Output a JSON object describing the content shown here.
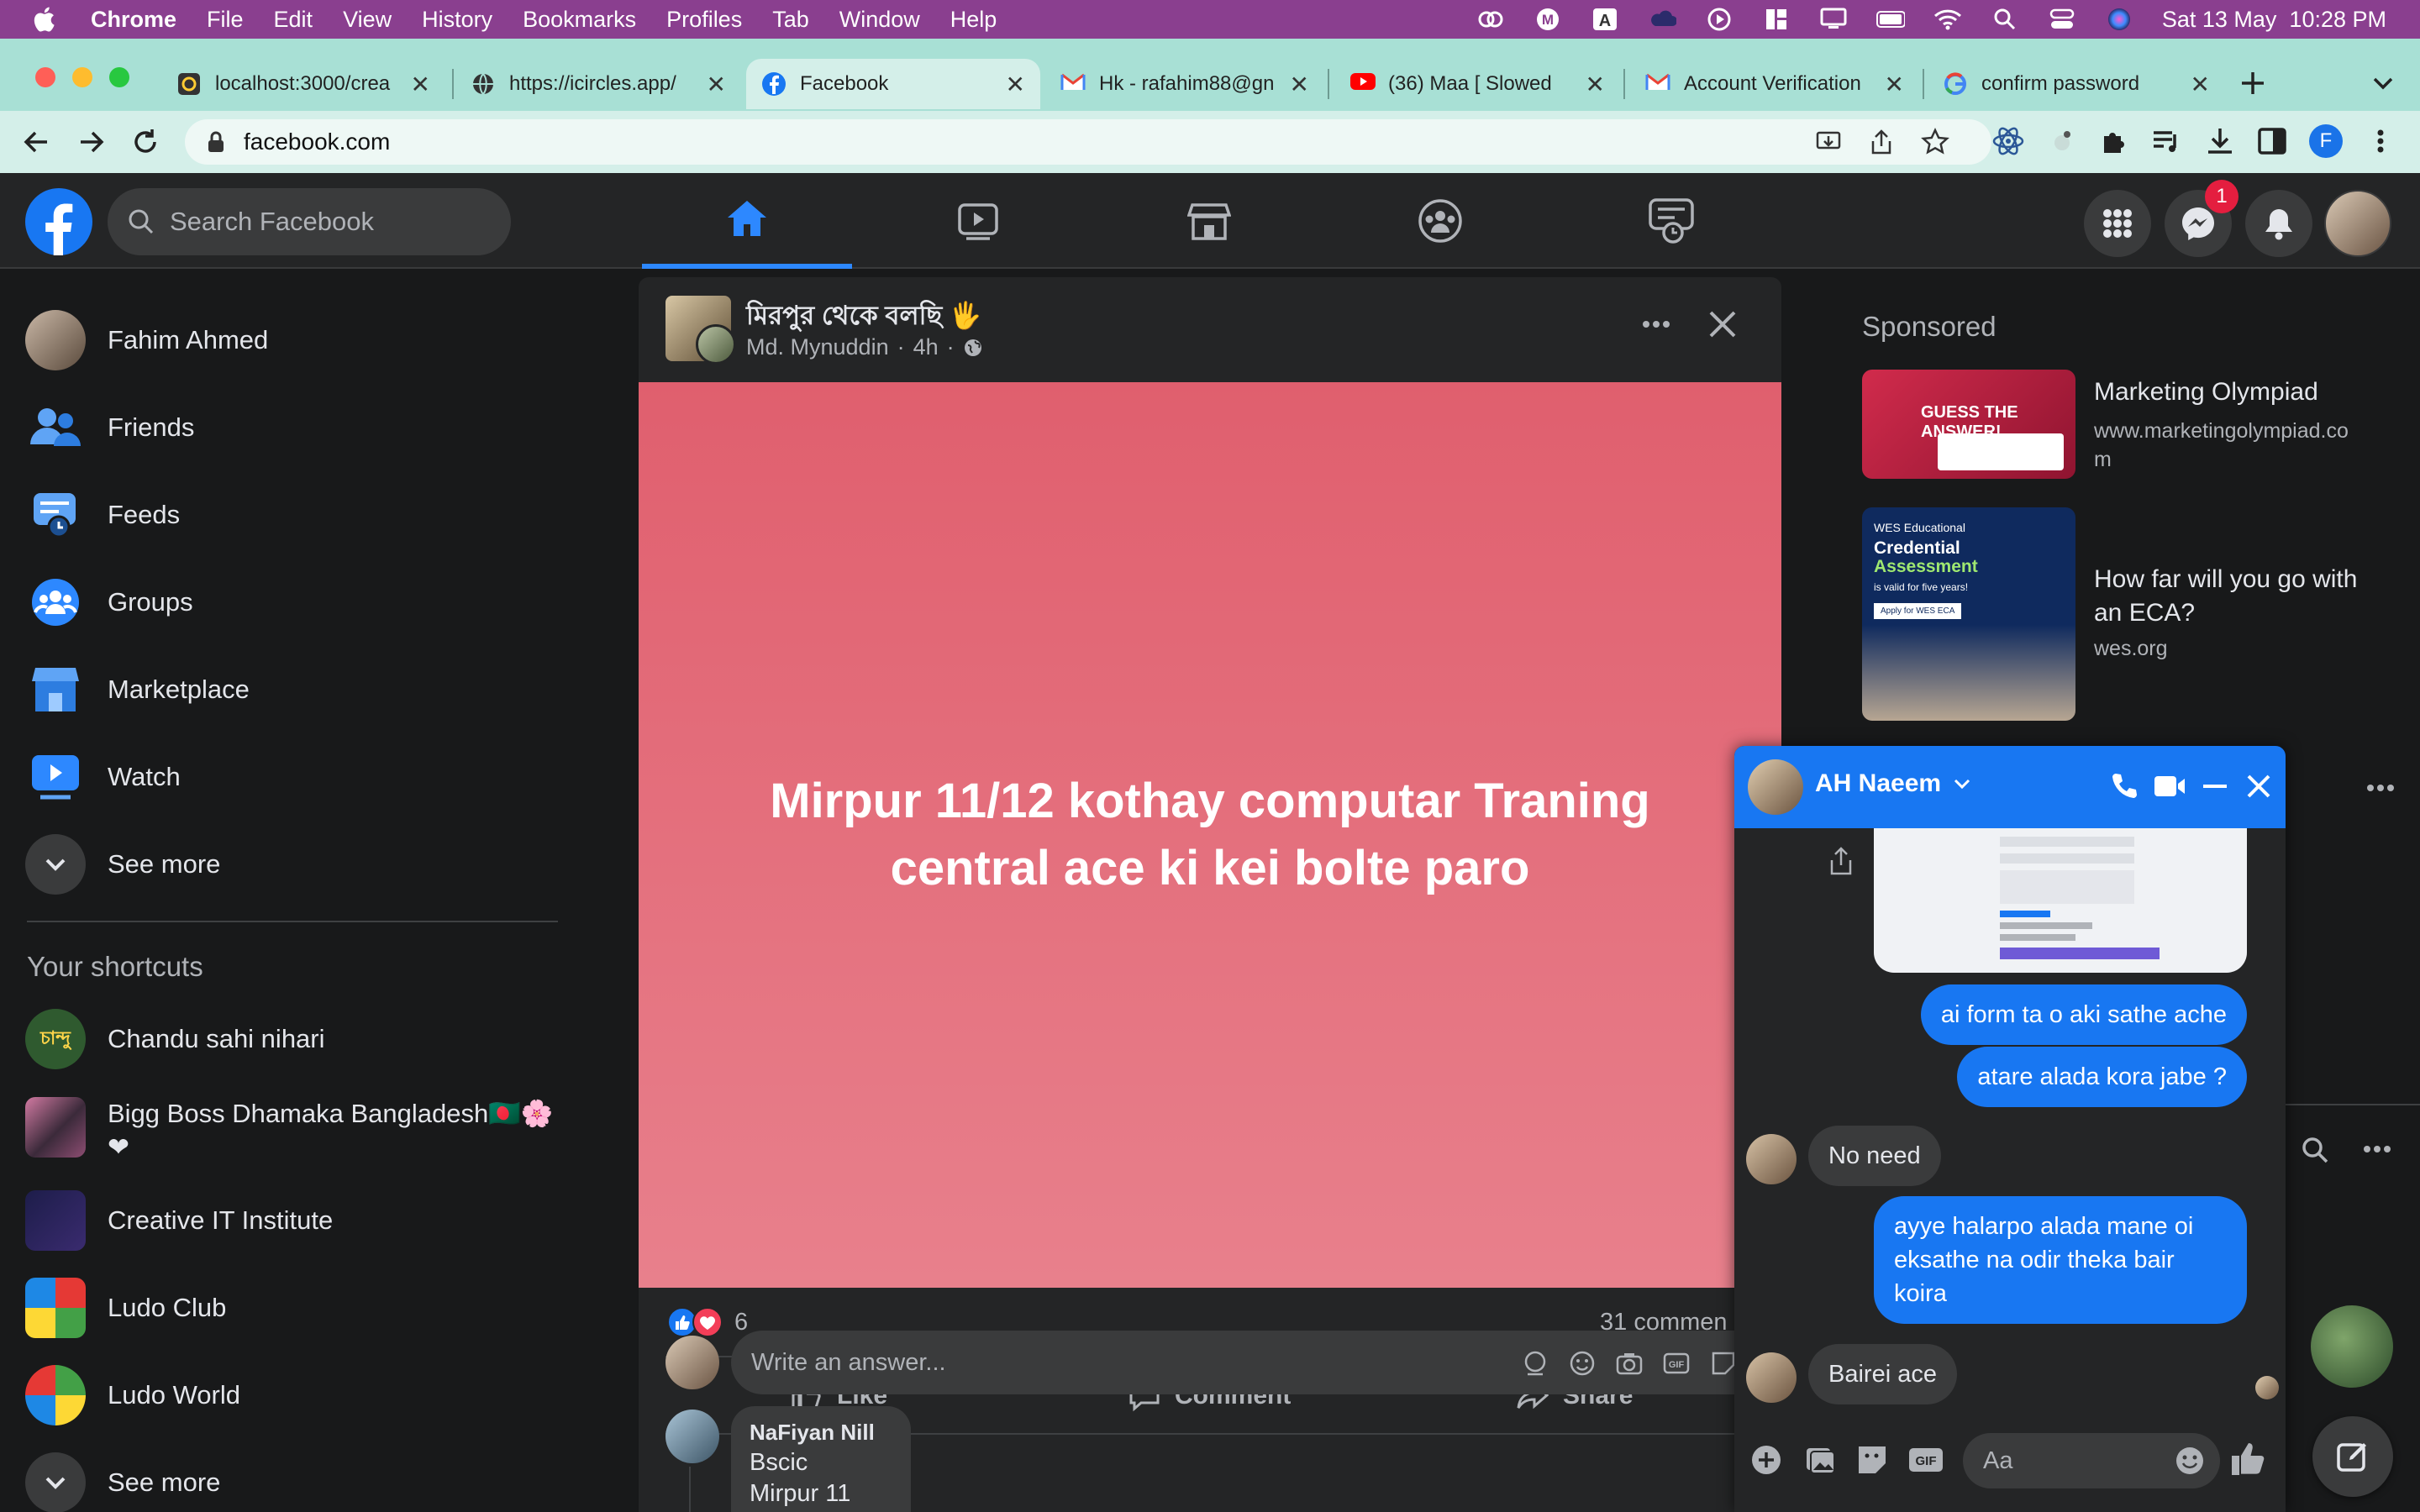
{
  "menubar": {
    "app_name": "Chrome",
    "items": [
      "File",
      "Edit",
      "View",
      "History",
      "Bookmarks",
      "Profiles",
      "Tab",
      "Window",
      "Help"
    ],
    "clock": "Sat 13 May  10:28 PM"
  },
  "browser": {
    "tabs": [
      {
        "label": "localhost:3000/crea",
        "icon": "localhost-favicon"
      },
      {
        "label": "https://icircles.app/",
        "icon": "globe-icon"
      },
      {
        "label": "Facebook",
        "icon": "facebook-favicon"
      },
      {
        "label": "Hk - rafahim88@gn",
        "icon": "gmail-icon"
      },
      {
        "label": "(36) Maa [ Slowed",
        "icon": "youtube-icon"
      },
      {
        "label": "Account Verification",
        "icon": "gmail-icon"
      },
      {
        "label": "confirm password",
        "icon": "google-icon"
      }
    ],
    "url": "facebook.com",
    "profile_initial": "F"
  },
  "fb_header": {
    "search_placeholder": "Search Facebook",
    "messenger_badge": "1"
  },
  "sidebar": {
    "user_name": "Fahim Ahmed",
    "items": [
      {
        "label": "Friends"
      },
      {
        "label": "Feeds"
      },
      {
        "label": "Groups"
      },
      {
        "label": "Marketplace"
      },
      {
        "label": "Watch"
      },
      {
        "label": "See more"
      }
    ],
    "shortcuts_title": "Your shortcuts",
    "shortcuts": [
      {
        "label": "Chandu sahi nihari"
      },
      {
        "label": "Bigg Boss Dhamaka Bangladesh🇧🇩🌸",
        "label2": "❤"
      },
      {
        "label": "Creative IT Institute"
      },
      {
        "label": "Ludo Club"
      },
      {
        "label": "Ludo World"
      },
      {
        "label": "See more"
      }
    ],
    "chandu_logo_text": "চান্দু"
  },
  "post": {
    "group_title": "মিরপুর থেকে বলছি 🖐",
    "author": "Md. Mynuddin",
    "time": "4h",
    "dot": "·",
    "body": "Mirpur 11/12 kothay computar Traning central ace ki kei bolte paro",
    "reaction_count": "6",
    "comments_count": "31 commen",
    "actions": {
      "like": "Like",
      "comment": "Comment",
      "share": "Share"
    },
    "answer_placeholder": "Write an answer...",
    "comment": {
      "name": "NaFiyan Nill",
      "line1": "Bscic",
      "line2": "Mirpur 11"
    }
  },
  "sponsored": {
    "title": "Sponsored",
    "ads": [
      {
        "title": "Marketing Olympiad",
        "domain_line1": "www.marketingolympiad.co",
        "domain_line2": "m",
        "img_text": "GUESS THE ANSWER!"
      },
      {
        "title_line1": "How far will you go with",
        "title_line2": "an ECA?",
        "domain": "wes.org",
        "img_label": "WES Educational",
        "img_title_line1": "Credential",
        "img_title_line2": "Assessment",
        "img_sub": "is valid for five years!",
        "img_btn": "Apply for WES ECA"
      }
    ]
  },
  "chat": {
    "name": "AH Naeem",
    "messages": [
      {
        "from": "me",
        "text": "ai form ta o aki sathe ache"
      },
      {
        "from": "me",
        "text": "atare alada kora jabe ?"
      },
      {
        "from": "them",
        "text": "No need"
      },
      {
        "from": "me",
        "lines": [
          "ayye  halarpo alada mane oi",
          "eksathe na odir theka bair",
          "koira"
        ]
      },
      {
        "from": "them",
        "text": "Bairei ace"
      }
    ],
    "input_placeholder": "Aa"
  },
  "colors": {
    "fb_blue": "#1877f2",
    "fb_dark": "#242526",
    "fb_bg": "#18191a",
    "post_bg": "#e36a78",
    "menubar": "#8a3f8f",
    "tabstrip": "#a8e0d5"
  }
}
